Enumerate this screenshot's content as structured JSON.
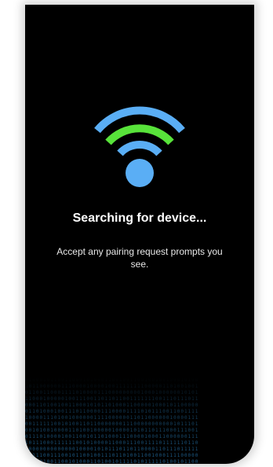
{
  "screen": {
    "title": "Searching for device...",
    "subtitle": "Accept any pairing request prompts you see."
  },
  "signal_icon": {
    "name": "wifi-signal-icon",
    "arc_colors": {
      "outer": "#5aaef5",
      "middle": "#58e33a",
      "inner": "#5aaef5",
      "dot": "#5aaef5"
    },
    "highlighted_arc": "middle"
  },
  "background": {
    "screen_color": "#000000",
    "rain_color": "#1e5f8c",
    "decoration": "binary-rain"
  }
}
